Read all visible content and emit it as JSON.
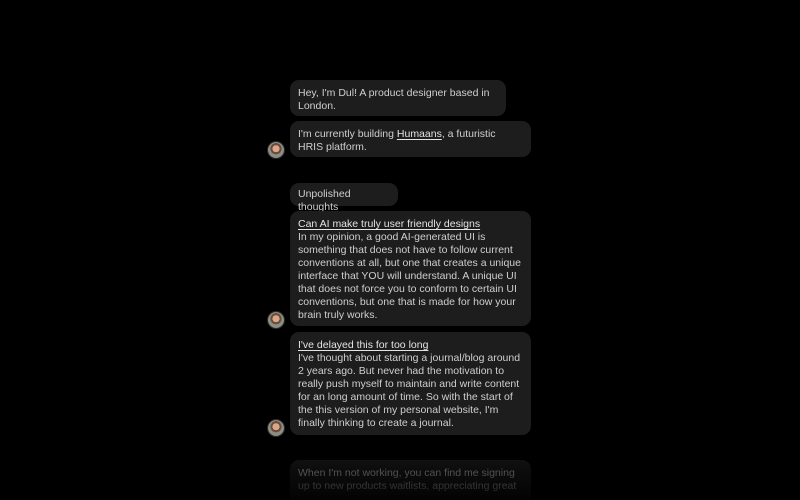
{
  "intro": {
    "greeting": "Hey, I'm Dul! A product designer based in London.",
    "building_prefix": "I'm currently building ",
    "building_link": "Humaans",
    "building_suffix": ", a futuristic HRIS platform."
  },
  "section": {
    "label": "Unpolished thoughts"
  },
  "posts": [
    {
      "title": "Can AI make truly user friendly designs",
      "body": "In my opinion, a good AI-generated UI is something that does not have to follow current conventions at all, but one that creates a unique interface that YOU will understand. A unique UI that does not force you to conform to certain UI conventions, but one that is made for how your brain truly works."
    },
    {
      "title": "I've delayed this for too long",
      "body": "I've thought about starting a journal/blog around 2 years ago. But never had the motivation to really push myself to maintain and write content for an long amount of time. So with the start of the this version of my personal website, I'm finally thinking to create a journal."
    }
  ],
  "footer_message": {
    "text": "When I'm not working, you can find me signing up to new products waitlists, appreciating great"
  }
}
